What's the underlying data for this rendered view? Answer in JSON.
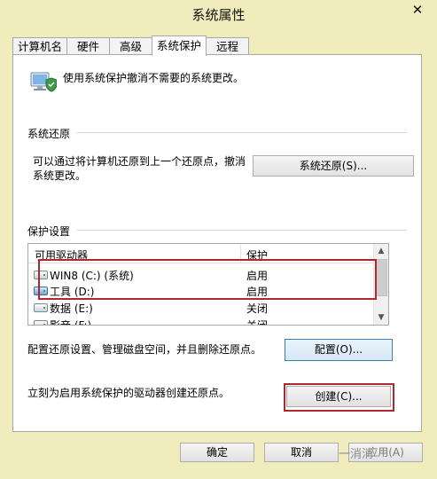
{
  "window": {
    "title": "系统属性",
    "close_glyph": "✕"
  },
  "tabs": [
    {
      "label": "计算机名"
    },
    {
      "label": "硬件"
    },
    {
      "label": "高级"
    },
    {
      "label": "系统保护"
    },
    {
      "label": "远程"
    }
  ],
  "intro": {
    "text": "使用系统保护撤消不需要的系统更改。"
  },
  "restore": {
    "section_label": "系统还原",
    "description_line1": "可以通过将计算机还原到上一个还原点，撤消",
    "description_line2": "系统更改。",
    "button_label": "系统还原(S)..."
  },
  "protection": {
    "section_label": "保护设置",
    "col_drive": "可用驱动器",
    "col_protection": "保护",
    "drives": [
      {
        "name": "WIN8 (C:) (系统)",
        "state": "启用"
      },
      {
        "name": "工具 (D:)",
        "state": "启用"
      },
      {
        "name": "数据 (E:)",
        "state": "关闭"
      },
      {
        "name": "影音 (F:)",
        "state": "关闭"
      }
    ],
    "configure_text": "配置还原设置、管理磁盘空间，并且删除还原点。",
    "configure_button": "配置(O)...",
    "create_text": "立刻为启用系统保护的驱动器创建还原点。",
    "create_button": "创建(C)..."
  },
  "footer": {
    "ok": "确定",
    "cancel": "取消",
    "apply": "应用(A)"
  },
  "watermark": "一消消",
  "colors": {
    "highlight": "#b0282e",
    "window_bg": "#f0ecbc"
  }
}
